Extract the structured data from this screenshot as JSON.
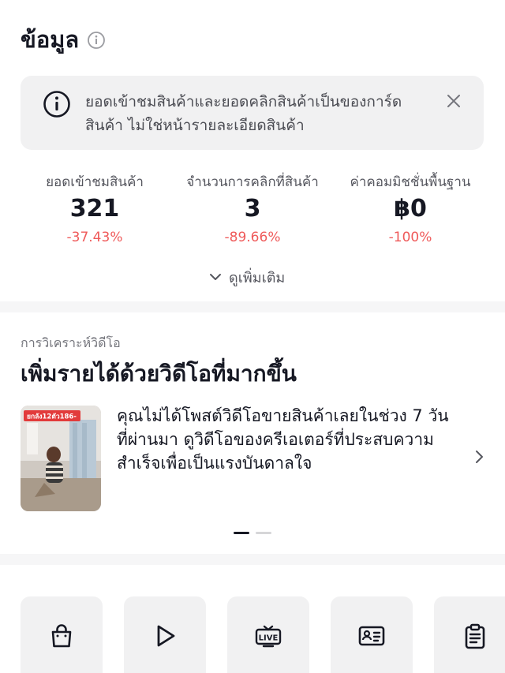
{
  "section": {
    "title": "ข้อมูล"
  },
  "notice": {
    "text": "ยอดเข้าชมสินค้าและยอดคลิกสินค้าเป็นของการ์ดสินค้า ไม่ใช่หน้ารายละเอียดสินค้า"
  },
  "stats": [
    {
      "label": "ยอดเข้าชมสินค้า",
      "value": "321",
      "change": "-37.43%"
    },
    {
      "label": "จำนวนการคลิกที่สินค้า",
      "value": "3",
      "change": "-89.66%"
    },
    {
      "label": "ค่าคอมมิชชั่นพื้นฐาน",
      "value": "฿0",
      "change": "-100%"
    }
  ],
  "more": {
    "label": "ดูเพิ่มเติม"
  },
  "analysis": {
    "kicker": "การวิเคราะห์วิดีโอ",
    "title": "เพิ่มรายได้ด้วยวิดีโอที่มากขึ้น",
    "card_text": "คุณไม่ได้โพสต์วิดีโอขายสินค้าเลยในช่วง 7 วันที่ผ่านมา ดูวิดีโอของครีเอเตอร์ที่ประสบความสำเร็จเพื่อเป็นแรงบันดาลใจ",
    "thumb_badge": "ยกลัง12ตัว186-"
  },
  "pager": {
    "count": 2,
    "active": 0
  },
  "tiles": [
    {
      "icon": "shopping-bag-icon"
    },
    {
      "icon": "play-icon"
    },
    {
      "icon": "live-icon"
    },
    {
      "icon": "id-card-icon"
    },
    {
      "icon": "clipboard-icon"
    }
  ],
  "colors": {
    "negative": "#ef5a5a",
    "text": "#161823",
    "muted": "#55565e",
    "panel": "#f1f1f2"
  }
}
